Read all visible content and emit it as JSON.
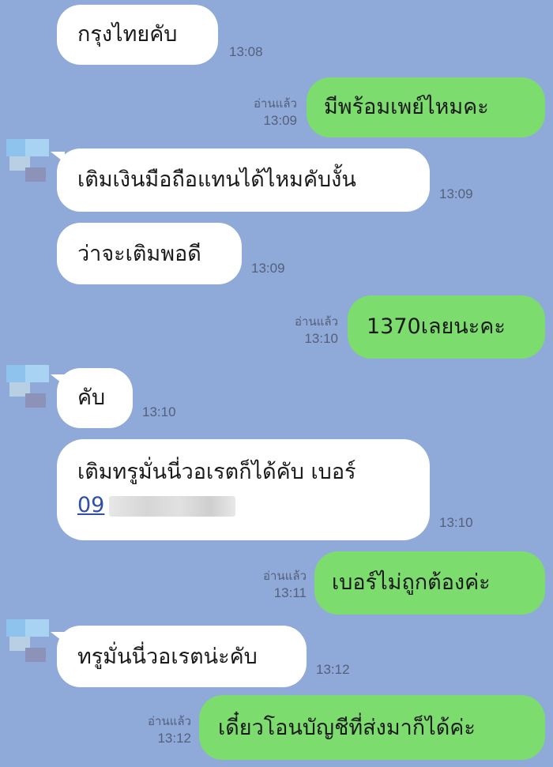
{
  "conversation": {
    "messages": [
      {
        "dir": "in",
        "text": "กรุงไทยคับ",
        "time": "13:08"
      },
      {
        "dir": "out",
        "text": "มีพร้อมเพย์ไหมคะ",
        "read": "อ่านแล้ว",
        "time": "13:09"
      },
      {
        "dir": "in",
        "text": "เติมเงินมือถือแทนได้ไหมคับงั้น",
        "time": "13:09"
      },
      {
        "dir": "in",
        "text": "ว่าจะเติมพอดี",
        "time": "13:09"
      },
      {
        "dir": "out",
        "text": "1370เลยนะคะ",
        "read": "อ่านแล้ว",
        "time": "13:10"
      },
      {
        "dir": "in",
        "text": "คับ",
        "time": "13:10"
      },
      {
        "dir": "in",
        "text": "เติมทรูมั่นนี่วอเรตก็ได้คับ เบอร์",
        "link": "09",
        "time": "13:10"
      },
      {
        "dir": "out",
        "text": "เบอร์ไม่ถูกต้องค่ะ",
        "read": "อ่านแล้ว",
        "time": "13:11"
      },
      {
        "dir": "in",
        "text": "ทรูมั่นนี่วอเรตน่ะคับ",
        "time": "13:12"
      },
      {
        "dir": "out",
        "text": "เดี๋ยวโอนบัญชีที่ส่งมาก็ได้ค่ะ",
        "read": "อ่านแล้ว",
        "time": "13:12"
      }
    ]
  },
  "colors": {
    "background": "#8fa9d8",
    "incoming_bubble": "#ffffff",
    "outgoing_bubble": "#7ddc6e",
    "link": "#2f4fa8"
  },
  "icons": {
    "avatar": "pixelated-avatar-icon"
  }
}
